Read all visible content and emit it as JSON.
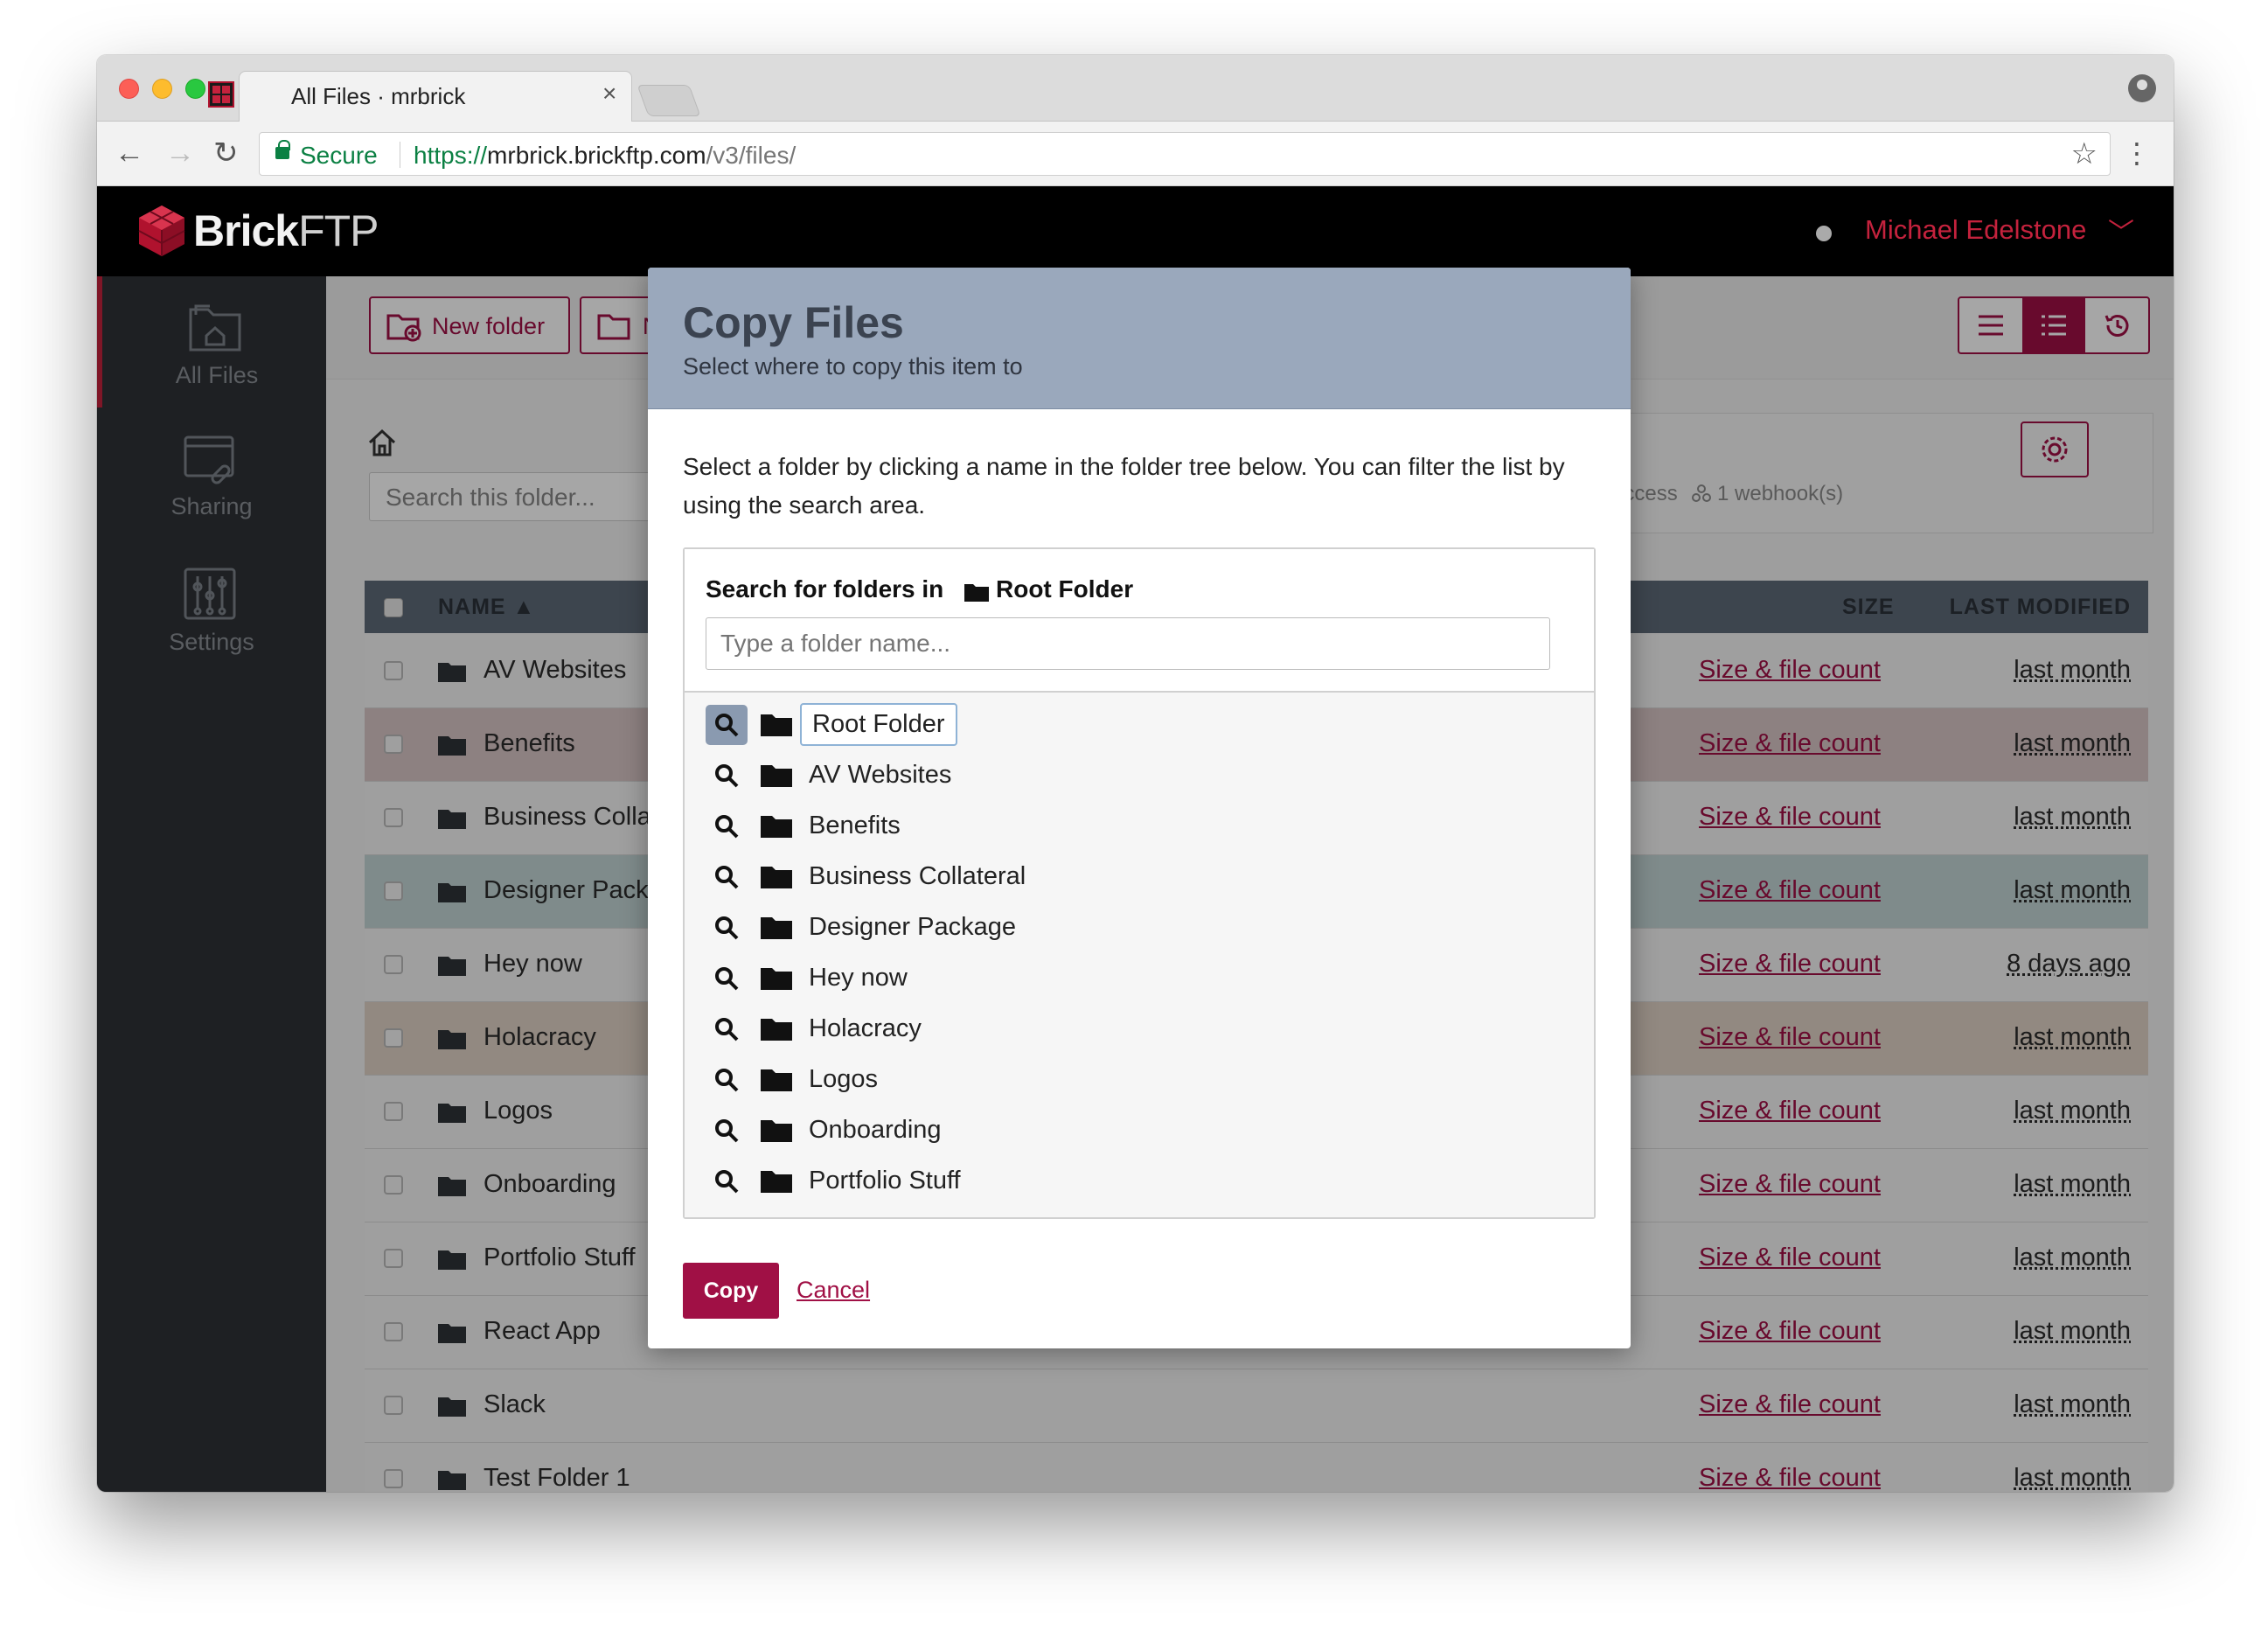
{
  "browser": {
    "tab_title": "All Files · mrbrick",
    "tab_close": "×",
    "secure_label": "Secure",
    "url_scheme": "https://",
    "url_host": "mrbrick.brickftp.com",
    "url_path": "/v3/files/"
  },
  "header": {
    "logo_bold": "Brick",
    "logo_light": "FTP",
    "user_name": "Michael Edelstone"
  },
  "sidebar": {
    "items": [
      {
        "label": "All Files"
      },
      {
        "label": "Sharing"
      },
      {
        "label": "Settings"
      }
    ]
  },
  "toolbar": {
    "new_folder": "New folder",
    "second_button_fragment": "N"
  },
  "folder_view": {
    "search_placeholder": "Search this folder...",
    "info_fragment": "s",
    "access_fragment": "e access",
    "webhooks": "1 webhook(s)"
  },
  "table": {
    "col_name": "NAME ▲",
    "col_size": "SIZE",
    "col_modified": "LAST MODIFIED",
    "row_colors": [
      "#f4f4f4",
      "#d9c6c6",
      "#f4f4f4",
      "#c4d6d6",
      "#f4f4f4",
      "#e0d3c6",
      "#f4f4f4",
      "#f4f4f4",
      "#f4f4f4",
      "#f4f4f4",
      "#f4f4f4",
      "#f4f4f4"
    ],
    "rows": [
      {
        "name": "AV Websites",
        "size": "Size & file count",
        "modified": "last month"
      },
      {
        "name": "Benefits",
        "size": "Size & file count",
        "modified": "last month"
      },
      {
        "name": "Business Colla",
        "size": "Size & file count",
        "modified": "last month"
      },
      {
        "name": "Designer Pack",
        "size": "Size & file count",
        "modified": "last month"
      },
      {
        "name": "Hey now",
        "size": "Size & file count",
        "modified": "8 days ago"
      },
      {
        "name": "Holacracy",
        "size": "Size & file count",
        "modified": "last month"
      },
      {
        "name": "Logos",
        "size": "Size & file count",
        "modified": "last month"
      },
      {
        "name": "Onboarding",
        "size": "Size & file count",
        "modified": "last month"
      },
      {
        "name": "Portfolio Stuff",
        "size": "Size & file count",
        "modified": "last month"
      },
      {
        "name": "React App",
        "size": "Size & file count",
        "modified": "last month"
      },
      {
        "name": "Slack",
        "size": "Size & file count",
        "modified": "last month"
      },
      {
        "name": "Test Folder 1",
        "size": "Size & file count",
        "modified": "last month"
      }
    ]
  },
  "modal": {
    "title": "Copy Files",
    "subtitle": "Select where to copy this item to",
    "description": "Select a folder by clicking a name in the folder tree below. You can filter the list by using the search area.",
    "search_label": "Search for folders in",
    "search_root": "Root Folder",
    "search_placeholder": "Type a folder name...",
    "tree": [
      {
        "name": "Root Folder"
      },
      {
        "name": "AV Websites"
      },
      {
        "name": "Benefits"
      },
      {
        "name": "Business Collateral"
      },
      {
        "name": "Designer Package"
      },
      {
        "name": "Hey now"
      },
      {
        "name": "Holacracy"
      },
      {
        "name": "Logos"
      },
      {
        "name": "Onboarding"
      },
      {
        "name": "Portfolio Stuff"
      }
    ],
    "copy_label": "Copy",
    "cancel_label": "Cancel"
  },
  "colors": {
    "brand": "#a01045",
    "header_bg": "#000000",
    "sidebar_bg": "#2e3237",
    "modal_head": "#9aa8bc"
  }
}
